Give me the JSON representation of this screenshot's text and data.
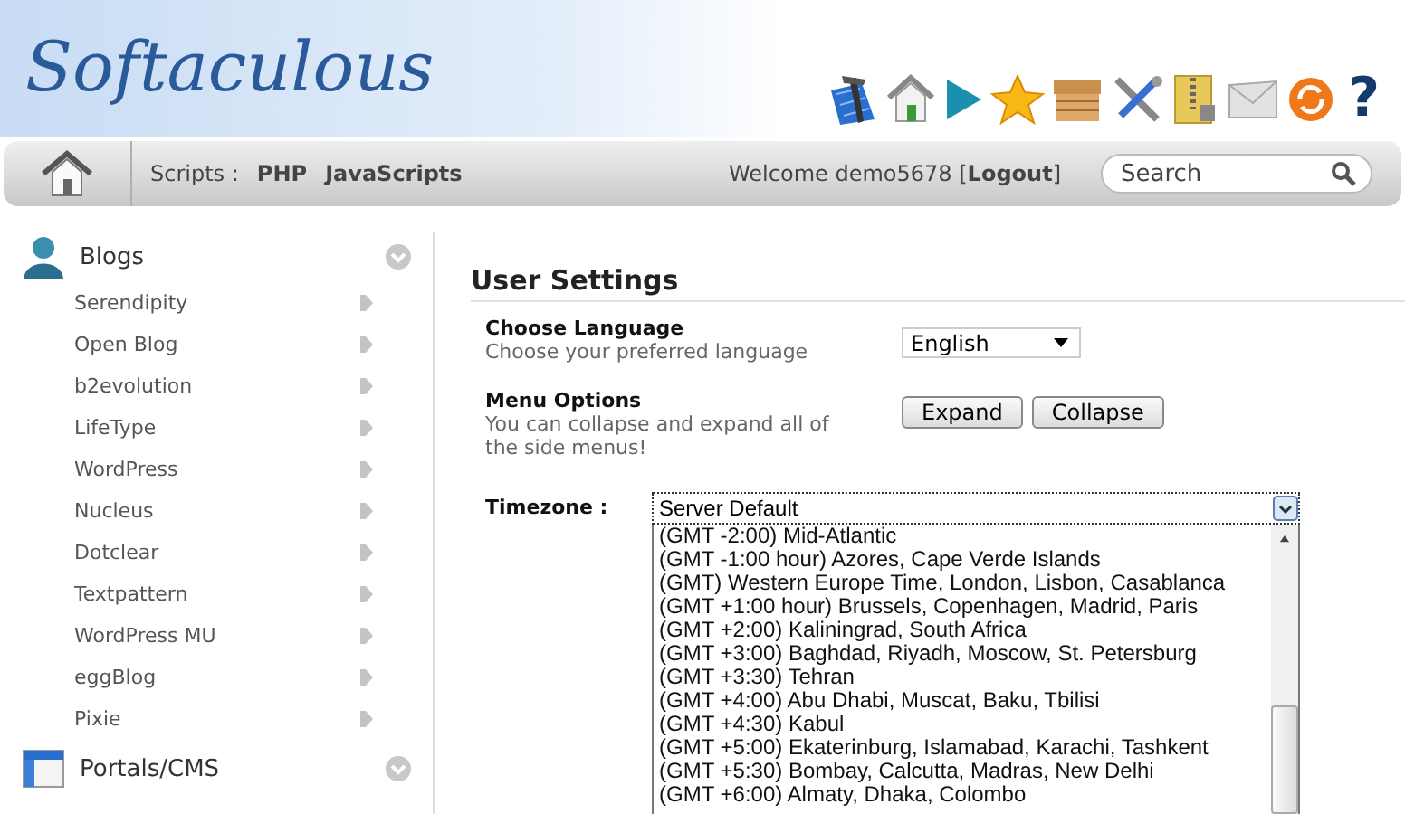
{
  "header": {
    "logo": "Softaculous",
    "help_label": "?"
  },
  "navbar": {
    "scripts_label": "Scripts :",
    "links": [
      "PHP",
      "JavaScripts"
    ],
    "welcome": "Welcome demo5678 [**Logout**]",
    "search": {
      "placeholder": "Search"
    }
  },
  "sidebar": {
    "categories": [
      {
        "name": "Blogs",
        "items": [
          "Serendipity",
          "Open Blog",
          "b2evolution",
          "LifeType",
          "WordPress",
          "Nucleus",
          "Dotclear",
          "Textpattern",
          "WordPress MU",
          "eggBlog",
          "Pixie"
        ]
      },
      {
        "name": "Portals/CMS"
      }
    ]
  },
  "settings": {
    "title": "User Settings",
    "language": {
      "label": "Choose Language",
      "hint": "Choose your preferred language",
      "value": "English"
    },
    "menu_options": {
      "label": "Menu Options",
      "hint": "You can collapse and expand all of the side menus!",
      "buttons": [
        "Expand",
        "Collapse"
      ]
    },
    "timezone": {
      "label": "Timezone :",
      "value": "Server Default",
      "expanded": true,
      "options": [
        "(GMT -2:00) Mid-Atlantic",
        "(GMT -1:00 hour) Azores, Cape Verde Islands",
        "(GMT) Western Europe Time, London, Lisbon, Casablanca",
        "(GMT +1:00 hour) Brussels, Copenhagen, Madrid, Paris",
        "(GMT +2:00) Kaliningrad, South Africa",
        "(GMT +3:00) Baghdad, Riyadh, Moscow, St. Petersburg",
        "(GMT +3:30) Tehran",
        "(GMT +4:00) Abu Dhabi, Muscat, Baku, Tbilisi",
        "(GMT +4:30) Kabul",
        "(GMT +5:00) Ekaterinburg, Islamabad, Karachi, Tashkent",
        "(GMT +5:30) Bombay, Calcutta, Madras, New Delhi",
        "(GMT +6:00) Almaty, Dhaka, Colombo"
      ]
    }
  }
}
